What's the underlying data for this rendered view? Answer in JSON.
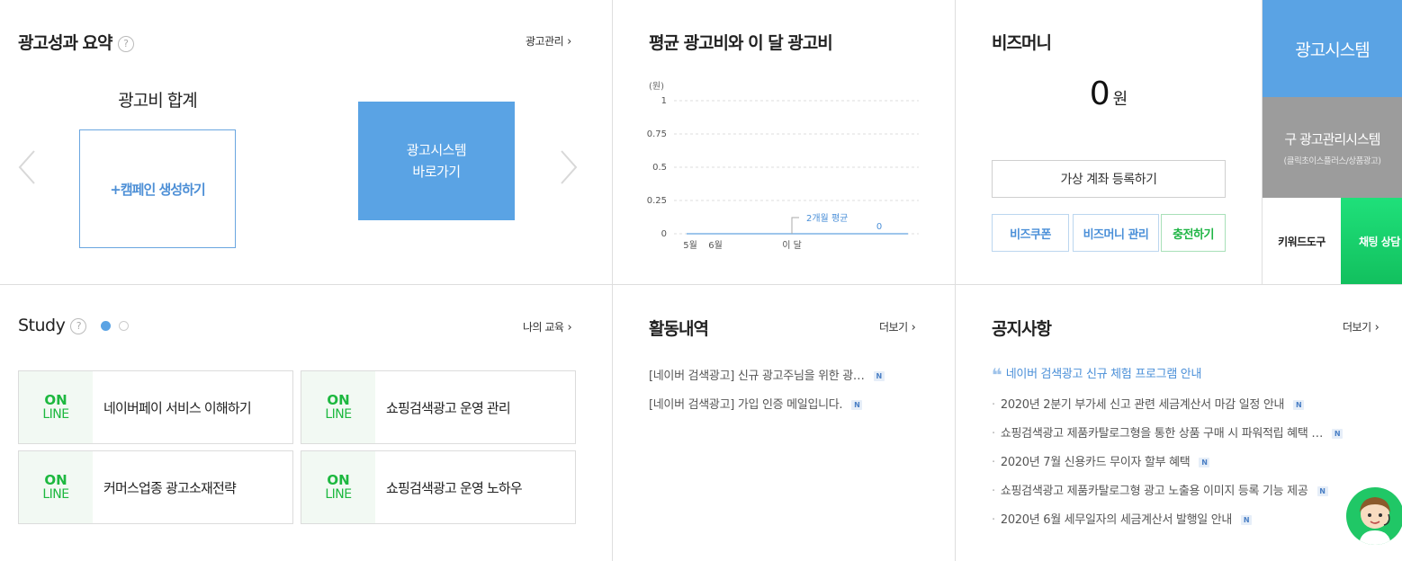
{
  "ad_summary": {
    "title": "광고성과 요약",
    "help": "?",
    "manage_link": "광고관리",
    "sum_label": "광고비 합계",
    "create_campaign": "+캠페인 생성하기",
    "adsys_line1": "광고시스템",
    "adsys_line2": "바로가기"
  },
  "avg_cost": {
    "title": "평균 광고비와 이 달 광고비"
  },
  "chart_data": {
    "type": "line",
    "unit_label": "(원)",
    "ylim": [
      0,
      1
    ],
    "y_ticks": [
      "1",
      "0.75",
      "0.5",
      "0.25",
      "0"
    ],
    "categories": [
      "5월",
      "6월",
      "이 달"
    ],
    "values": [
      0,
      0,
      0
    ],
    "annotation": "2개월 평균",
    "current_value_label": "0",
    "grid": true
  },
  "bizmoney": {
    "title": "비즈머니",
    "amount": "0",
    "unit": "원",
    "register_button": "가상 계좌 등록하기",
    "coupon_button": "비즈쿠폰",
    "manage_button": "비즈머니 관리",
    "charge_button": "충전하기"
  },
  "side_tiles": {
    "adsys": "광고시스템",
    "old_system": "구 광고관리시스템",
    "old_system_sub": "(클릭초이스플러스/상품광고)",
    "keyword_tool": "키워드도구",
    "chat": "채팅 상담",
    "colors": {
      "adsys": "#5aa3e4",
      "old": "#9c9c9c",
      "chat": "#1fd36b"
    }
  },
  "study": {
    "title": "Study",
    "help": "?",
    "my_edu_link": "나의 교육",
    "badge_on": "ON",
    "badge_line": "LINE",
    "courses": [
      "네이버페이 서비스 이해하기",
      "쇼핑검색광고 운영 관리",
      "커머스업종 광고소재전략",
      "쇼핑검색광고 운영 노하우"
    ]
  },
  "activity": {
    "title": "활동내역",
    "more": "더보기",
    "items": [
      "[네이버 검색광고] 신규 광고주님을 위한 광…",
      "[네이버 검색광고] 가입 인증 메일입니다."
    ],
    "new_badge": "N"
  },
  "notice": {
    "title": "공지사항",
    "more": "더보기",
    "highlight": "네이버 검색광고 신규 체험 프로그램 안내",
    "items": [
      "2020년 2분기 부가세 신고 관련 세금계산서 마감 일정 안내",
      "쇼핑검색광고 제품카탈로그형을 통한 상품 구매 시 파워적립 혜택 …",
      "2020년 7월 신용카드 무이자 할부 혜택",
      "쇼핑검색광고 제품카탈로그형 광고 노출용 이미지 등록 기능 제공",
      "2020년 6월 세무일자의 세금계산서 발행일 안내"
    ],
    "new_badge": "N"
  }
}
